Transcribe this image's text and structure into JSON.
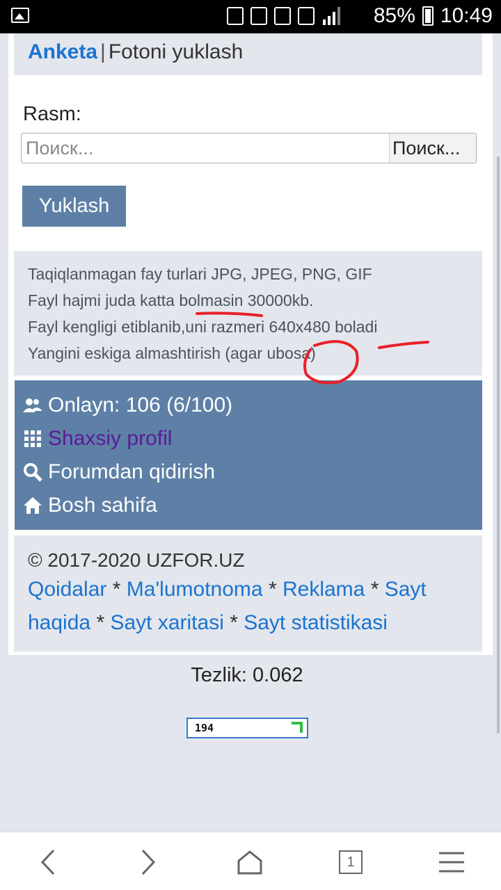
{
  "status": {
    "battery": "85%",
    "time": "10:49"
  },
  "header": {
    "link": "Anketa",
    "separator": "|",
    "title": "Fotoni yuklash"
  },
  "form": {
    "label": "Rasm:",
    "placeholder": "Поиск...",
    "browse_label": "Поиск...",
    "submit_label": "Yuklash"
  },
  "info": {
    "lines": [
      "Taqiqlanmagan fay turlari JPG, JPEG, PNG, GIF",
      "Fayl hajmi juda katta bolmasin 30000kb.",
      "Fayl kengligi etiblanib,uni razmeri 640x480 boladi",
      "Yangini eskiga almashtirish (agar ubosa)"
    ]
  },
  "menu": {
    "online": "Onlayn: 106 (6/100)",
    "profile": "Shaxsiy profil",
    "search": "Forumdan qidirish",
    "home": "Bosh sahifa"
  },
  "footer": {
    "copyright": "© 2017-2020 UZFOR.UZ",
    "links": [
      "Qoidalar",
      "Ma'lumotnoma",
      "Reklama",
      "Sayt haqida",
      "Sayt xaritasi",
      "Sayt statistikasi"
    ],
    "separator": "*"
  },
  "speed": "Tezlik: 0.062",
  "counter": "194",
  "nav": {
    "tabs_count": "1"
  },
  "colors": {
    "accent": "#5e80a6",
    "link": "#1a73d1",
    "visited": "#5a1a9a",
    "annotation": "#e8202a"
  }
}
